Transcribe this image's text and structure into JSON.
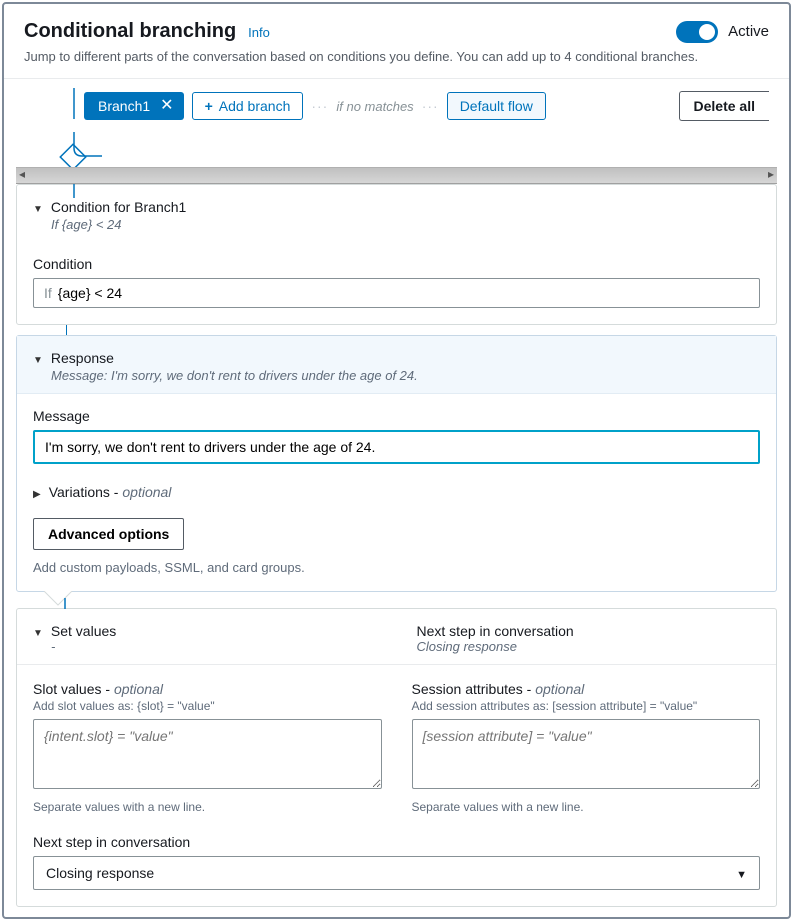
{
  "header": {
    "title": "Conditional branching",
    "info": "Info",
    "description": "Jump to different parts of the conversation based on conditions you define. You can add up to 4 conditional branches.",
    "toggle_label": "Active"
  },
  "branch_row": {
    "branch_chip": "Branch1",
    "add_branch": "Add branch",
    "if_no_matches": "if no matches",
    "default_flow": "Default flow",
    "delete_all": "Delete all"
  },
  "condition_panel": {
    "title": "Condition for Branch1",
    "subtitle": "If {age} < 24",
    "field_label": "Condition",
    "if_prefix": "If",
    "value": "{age} < 24"
  },
  "response_panel": {
    "title": "Response",
    "subtitle": "Message: I'm sorry, we don't rent to drivers under the age of 24.",
    "field_label": "Message",
    "value": "I'm sorry, we don't rent to drivers under the age of 24.",
    "variations_label": "Variations - ",
    "variations_optional": "optional",
    "advanced_btn": "Advanced options",
    "advanced_hint": "Add custom payloads, SSML, and card groups."
  },
  "setvalues_panel": {
    "title": "Set values",
    "dash": "-",
    "nextstep_title": "Next step in conversation",
    "nextstep_sub": "Closing response",
    "slot_label": "Slot values - ",
    "slot_optional": "optional",
    "slot_hint": "Add slot values as: {slot} = \"value\"",
    "slot_placeholder": "{intent.slot} = \"value\"",
    "slot_below": "Separate values with a new line.",
    "session_label": "Session attributes - ",
    "session_optional": "optional",
    "session_hint": "Add session attributes as: [session attribute] = \"value\"",
    "session_placeholder": "[session attribute] = \"value\"",
    "session_below": "Separate values with a new line.",
    "next_step_label": "Next step in conversation",
    "next_step_value": "Closing response"
  }
}
